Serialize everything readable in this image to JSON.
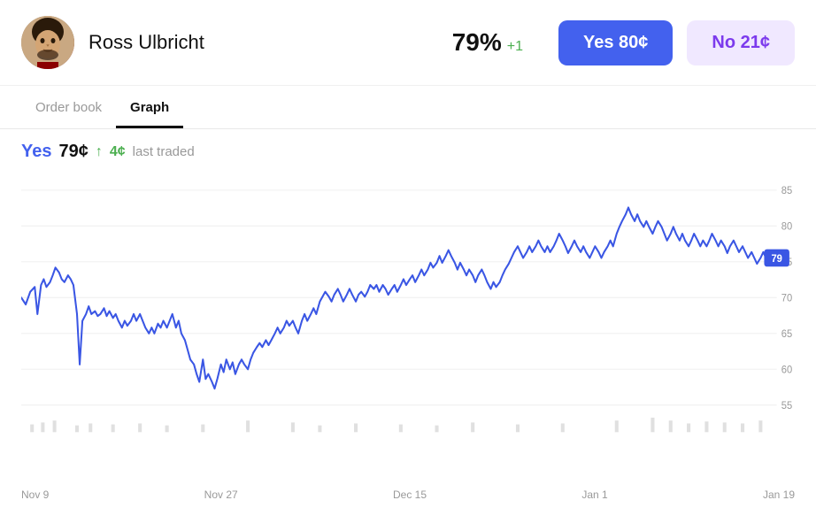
{
  "header": {
    "person_name": "Ross Ulbricht",
    "percentage": "79%",
    "percentage_change": "+1",
    "btn_yes_label": "Yes 80¢",
    "btn_no_label": "No 21¢"
  },
  "tabs": [
    {
      "id": "order-book",
      "label": "Order book",
      "active": false
    },
    {
      "id": "graph",
      "label": "Graph",
      "active": true
    }
  ],
  "chart": {
    "price_label": "Yes",
    "price_value": "79¢",
    "price_up": "4¢",
    "price_description": "last traded",
    "current_value": "79",
    "y_axis": [
      85,
      80,
      75,
      70,
      65,
      60,
      55
    ],
    "x_axis": [
      "Nov 9",
      "Nov 27",
      "Dec 15",
      "Jan 1",
      "Jan 19"
    ]
  }
}
